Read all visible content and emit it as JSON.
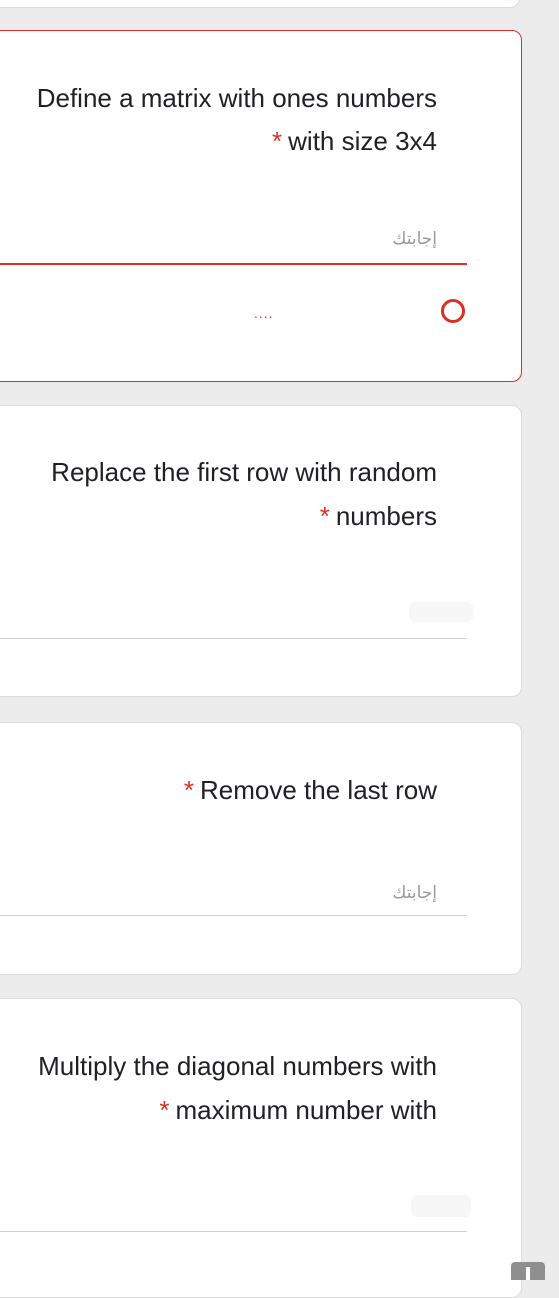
{
  "questions": [
    {
      "title_line1": "Define a matrix with ones numbers",
      "title_line2": "with size 3x4",
      "required_mark": "*",
      "placeholder": "إجابتك",
      "state": "error"
    },
    {
      "title_line1": "Replace the first row with random",
      "title_line2": "numbers",
      "required_mark": "*",
      "placeholder": "",
      "state": "normal"
    },
    {
      "title_line1": "",
      "title_line2": "Remove the last row",
      "required_mark": "*",
      "placeholder": "إجابتك",
      "state": "normal"
    },
    {
      "title_line1": "Multiply the diagonal numbers with",
      "title_line2": "maximum number with",
      "required_mark": "*",
      "placeholder": "",
      "state": "normal"
    }
  ],
  "colors": {
    "required": "#d93025",
    "error_border": "#d93025",
    "text": "#202124",
    "background": "#ececec"
  },
  "icons": {
    "error": "error-circle-icon",
    "scroll": "scrollbar-thumb"
  }
}
